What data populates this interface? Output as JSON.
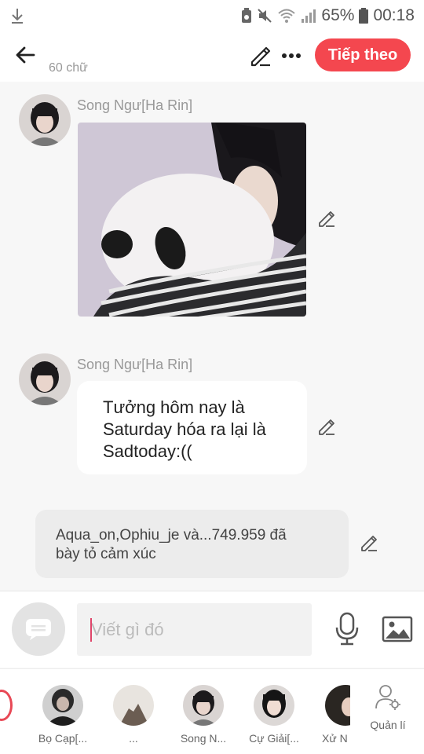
{
  "status_bar": {
    "battery": "65%",
    "time": "00:18",
    "icons": [
      "download-icon",
      "battery-saver-icon",
      "mute-icon",
      "wifi-icon",
      "signal-icon",
      "battery-icon"
    ]
  },
  "header": {
    "word_count": "60 chữ",
    "next_label": "Tiếp theo",
    "icons": [
      "back-arrow-icon",
      "pencil-icon",
      "more-dots-icon"
    ],
    "accent": "#f4474f"
  },
  "messages": [
    {
      "sender": "Song Ngư[Ha Rin]",
      "type": "image",
      "image_desc": "photo-girl-hugging-panda-plush"
    },
    {
      "sender": "Song Ngư[Ha Rin]",
      "type": "text",
      "lines": [
        "Tưởng hôm nay là",
        "Saturday hóa ra lại là",
        "Sadtoday:(("
      ]
    }
  ],
  "reactions": {
    "line1": "Aqua_on,Ophiu_je và...749.959 đã",
    "line2": "bày tỏ cảm xúc"
  },
  "composer": {
    "placeholder": "Viết gì đó",
    "icons": [
      "sticker-icon",
      "microphone-icon",
      "image-icon"
    ]
  },
  "people": [
    {
      "name": "Bọ Cạp[..."
    },
    {
      "name": "..."
    },
    {
      "name": "Song N..."
    },
    {
      "name": "Cự Giải[..."
    },
    {
      "name": "Xử N"
    }
  ],
  "manage_label": "Quản lí"
}
